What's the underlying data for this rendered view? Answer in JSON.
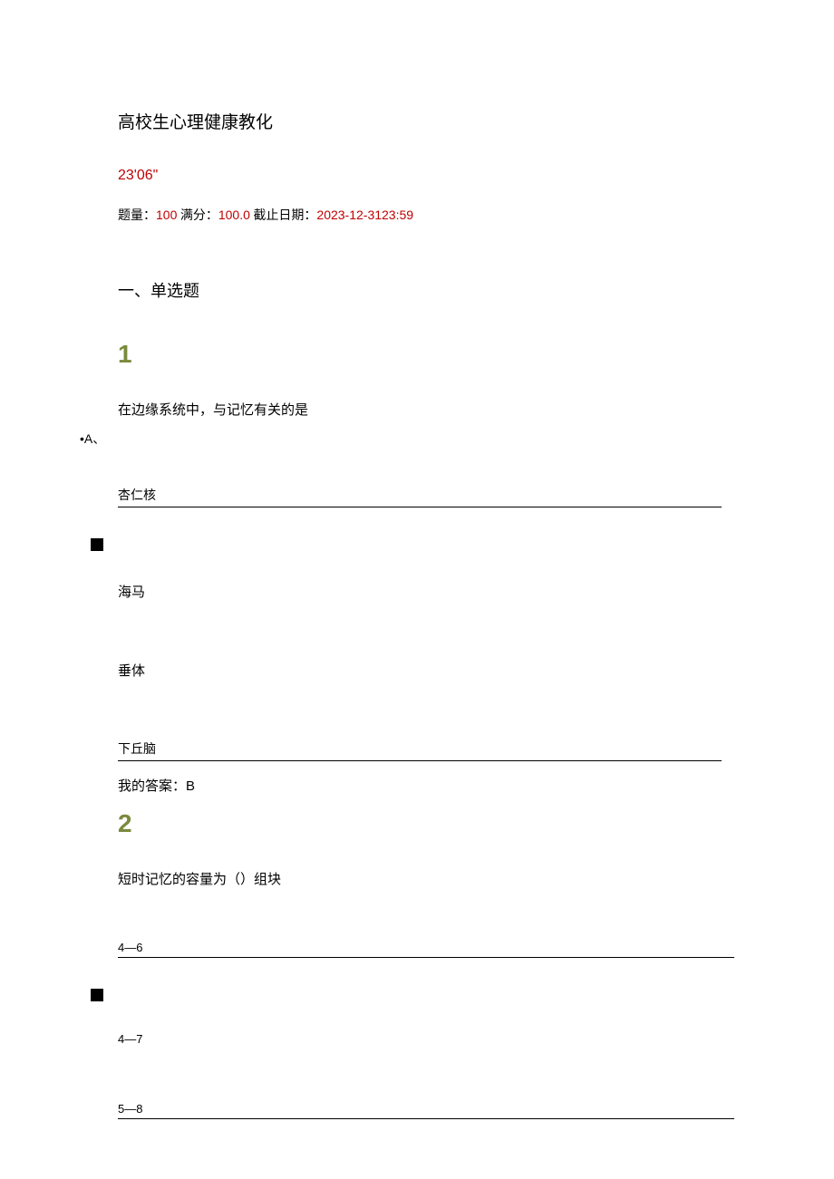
{
  "title": "高校生心理健康教化",
  "timer": "23'06\"",
  "meta": {
    "count_label": "题量：",
    "count_value": "100",
    "full_label": " 满分：",
    "full_value": "100.0",
    "deadline_label": " 截止日期：",
    "deadline_value": "2023-12-3123:59"
  },
  "section_title": "一、单选题",
  "q1": {
    "num": "1",
    "stem": "在边缘系统中，与记忆有关的是",
    "option_marker": "•A、",
    "a": "杏仁核",
    "b": "海马",
    "c": "垂体",
    "d": "下丘脑",
    "my_answer_label": "我的答案：",
    "my_answer_value": "B"
  },
  "q2": {
    "num": "2",
    "stem": "短时记忆的容量为（）组块",
    "a": "4—6",
    "b": "4—7",
    "c": "5—8"
  }
}
